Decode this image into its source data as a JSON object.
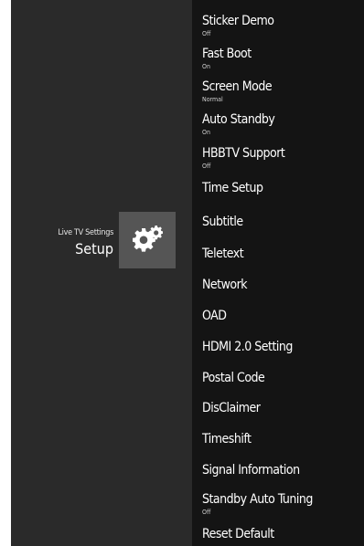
{
  "header": {
    "breadcrumb": "Live TV Settings",
    "title": "Setup",
    "icon": "gear-icon"
  },
  "menu": {
    "items": [
      {
        "label": "Sticker Demo",
        "value": "Off"
      },
      {
        "label": "Fast Boot",
        "value": "On"
      },
      {
        "label": "Screen Mode",
        "value": "Normal"
      },
      {
        "label": "Auto Standby",
        "value": "On"
      },
      {
        "label": "HBBTV Support",
        "value": "Off"
      },
      {
        "label": "Time Setup"
      },
      {
        "label": "Subtitle"
      },
      {
        "label": "Teletext"
      },
      {
        "label": "Network"
      },
      {
        "label": "OAD"
      },
      {
        "label": "HDMI 2.0 Setting"
      },
      {
        "label": "Postal Code"
      },
      {
        "label": "DisClaimer"
      },
      {
        "label": "Timeshift"
      },
      {
        "label": "Signal Information"
      },
      {
        "label": "Standby Auto Tuning",
        "value": "Off"
      },
      {
        "label": "Reset Default"
      }
    ]
  },
  "colors": {
    "left_panel": "#2a2a2a",
    "menu_panel": "#141414",
    "icon_tile": "#555555",
    "text": "#ffffff"
  }
}
